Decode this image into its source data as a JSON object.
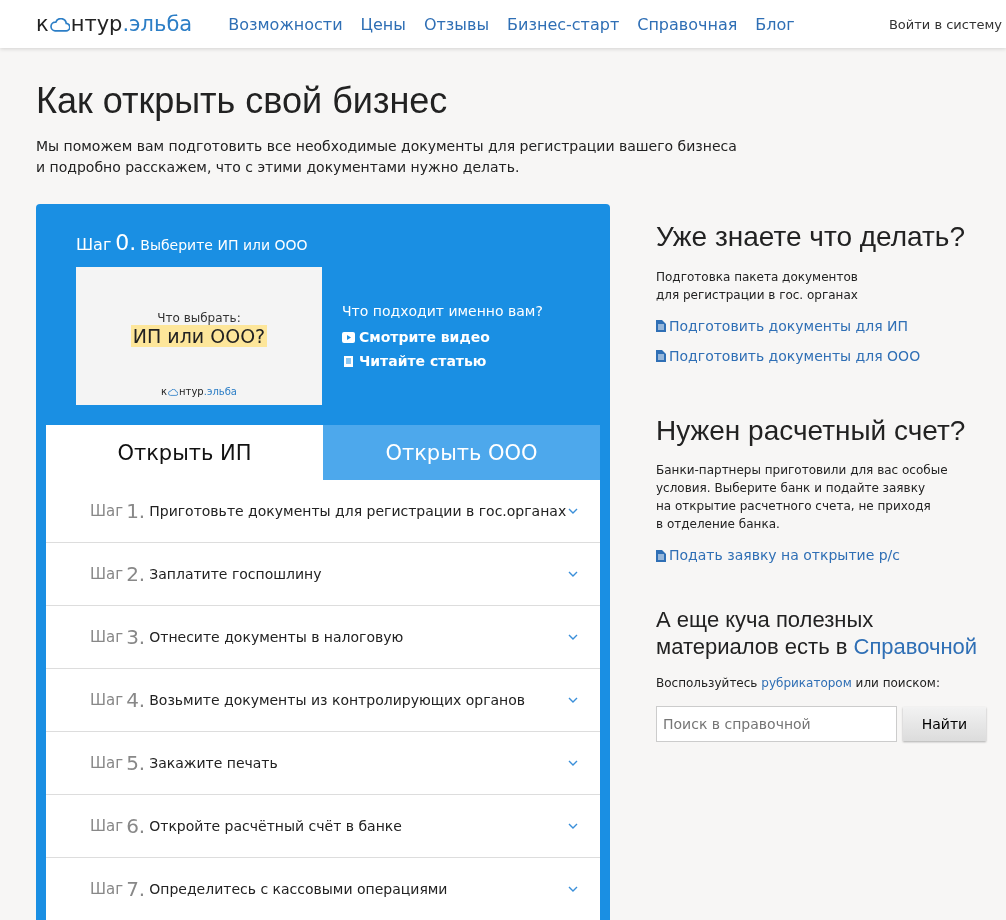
{
  "header": {
    "logo": {
      "prefix": "к",
      "middle": "нтур",
      "suffix": ".эльба"
    },
    "nav": [
      "Возможности",
      "Цены",
      "Отзывы",
      "Бизнес-старт",
      "Справочная",
      "Блог"
    ],
    "login": "Войти в систему"
  },
  "page": {
    "title": "Как открыть свой бизнес",
    "intro": "Мы поможем вам подготовить все необходимые документы для регистрации вашего бизнеса\nи подробно расскажем, что с этими документами нужно делать."
  },
  "step0": {
    "label": "Шаг",
    "number": "0.",
    "title": "Выберите ИП или ООО",
    "thumbnail": {
      "caption": "Что выбрать:",
      "headline": "ИП или ООО?",
      "logo": {
        "prefix": "к",
        "middle": "нтур",
        "suffix": ".эльба"
      }
    },
    "question": "Что подходит именно вам?",
    "links": [
      {
        "kind": "video",
        "text": "Смотрите видео"
      },
      {
        "kind": "article",
        "text": "Читайте статью"
      }
    ]
  },
  "tabs": [
    {
      "label": "Открыть ИП",
      "selected": true
    },
    {
      "label": "Открыть ООО",
      "selected": false
    }
  ],
  "steps": [
    {
      "label": "Шаг",
      "number": "1.",
      "title": "Приготовьте документы для регистрации в гос.органах"
    },
    {
      "label": "Шаг",
      "number": "2.",
      "title": "Заплатите госпошлину"
    },
    {
      "label": "Шаг",
      "number": "3.",
      "title": "Отнесите документы в налоговую"
    },
    {
      "label": "Шаг",
      "number": "4.",
      "title": "Возьмите документы из контролирующих органов"
    },
    {
      "label": "Шаг",
      "number": "5.",
      "title": "Закажите печать"
    },
    {
      "label": "Шаг",
      "number": "6.",
      "title": "Откройте расчётный счёт в банке"
    },
    {
      "label": "Шаг",
      "number": "7.",
      "title": "Определитесь с кассовыми операциями"
    }
  ],
  "sidebar": {
    "know": {
      "heading": "Уже знаете что делать?",
      "text": "Подготовка пакета документов\nдля регистрации в гос. органах",
      "links": [
        "Подготовить документы для ИП",
        "Подготовить документы для ООО"
      ]
    },
    "account": {
      "heading": "Нужен расчетный счет?",
      "text": "Банки-партнеры приготовили для вас особые\nусловия. Выберите банк и подайте заявку\nна открытие расчетного счета, не приходя\nв отделение банка.",
      "links": [
        "Подать заявку на открытие р/с"
      ]
    },
    "help": {
      "heading": "А еще куча полезных\nматериалов есть в",
      "heading_link": "Справочной",
      "hint_before": "Воспользуйтесь",
      "hint_link": "рубрикатором",
      "hint_after": "или поиском:",
      "search": {
        "placeholder": "Поиск в справочной"
      },
      "button": "Найти"
    }
  }
}
